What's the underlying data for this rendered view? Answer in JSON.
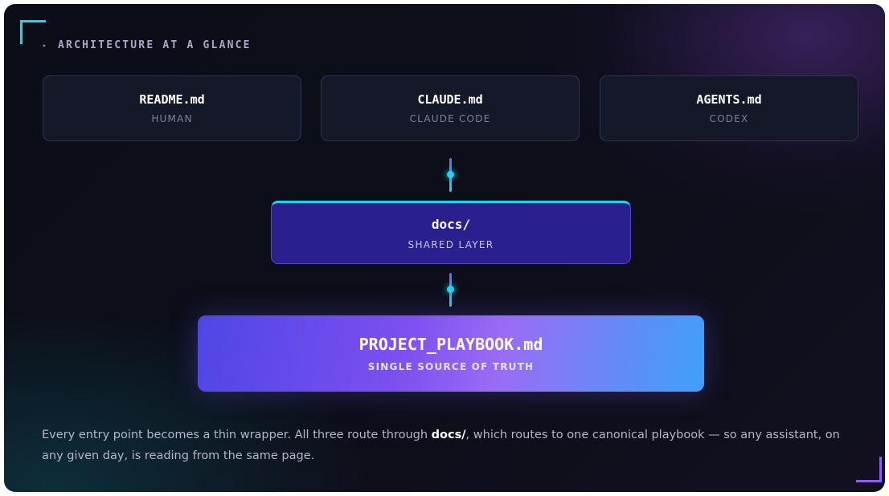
{
  "header": {
    "eyebrow_marker": "▸",
    "eyebrow": "ARCHITECTURE AT A GLANCE"
  },
  "entry_points": [
    {
      "file": "README.md",
      "audience": "HUMAN"
    },
    {
      "file": "CLAUDE.md",
      "audience": "CLAUDE CODE"
    },
    {
      "file": "AGENTS.md",
      "audience": "CODEX"
    }
  ],
  "shared_layer": {
    "name": "docs/",
    "label": "SHARED LAYER"
  },
  "playbook": {
    "name": "PROJECT_PLAYBOOK.md",
    "label": "SINGLE SOURCE OF TRUTH"
  },
  "caption": {
    "before": "Every entry point becomes a thin wrapper. All three route through ",
    "highlight": "docs/",
    "after": ", which routes to one canonical playbook — so any assistant, on any given day, is reading from the same page."
  },
  "colors": {
    "accent_cyan": "#22d3ee",
    "accent_violet": "#8b5cf6",
    "shared_layer_bg": "#2a1f8e",
    "playbook_gradient_start": "#4f46e5",
    "playbook_gradient_end": "#3ea1f9"
  }
}
